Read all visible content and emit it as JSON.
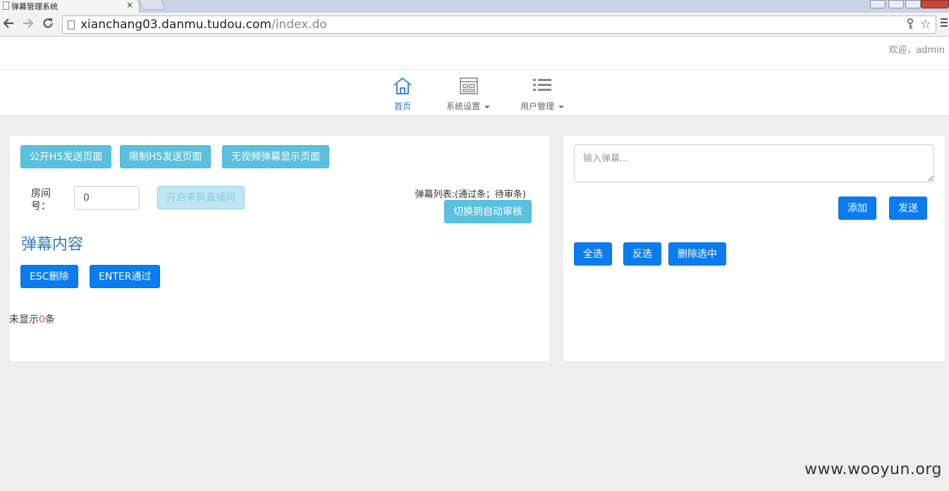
{
  "browser": {
    "tab_title": "弹幕管理系统",
    "tab_close": "×",
    "url_host": "xianchang03.danmu.tudou.com",
    "url_path": "/index.do"
  },
  "header": {
    "welcome": "欢迎，admin"
  },
  "nav": {
    "items": [
      {
        "label": "首页",
        "icon": "home-icon"
      },
      {
        "label": "系统设置",
        "icon": "settings-window-icon"
      },
      {
        "label": "用户管理",
        "icon": "list-icon"
      }
    ]
  },
  "left_panel": {
    "buttons": {
      "public_h5": "公开H5发送页面",
      "limit_h5": "限制H5发送页面",
      "no_video": "无视频弹幕显示页面"
    },
    "room_label": "房间号：",
    "room_value": "0",
    "start_live": "开启来疯直播间",
    "list_status": "弹幕列表:(通过条；待审条)",
    "switch_auto": "切换到自动审核",
    "section_title": "弹幕内容",
    "esc_delete": "ESC删除",
    "enter_pass": "ENTER通过",
    "count_prefix": "未显示",
    "count_value": "0",
    "count_suffix": "条"
  },
  "right_panel": {
    "danmu_placeholder": "输入弹幕...",
    "add": "添加",
    "send": "发送",
    "select_all": "全选",
    "invert": "反选",
    "delete_selected": "删除选中"
  },
  "watermark": "www.wooyun.org",
  "colors": {
    "info": "#5bc0de",
    "primary": "#0a7cf0",
    "nav_active": "#2f7bc2",
    "title": "#337ab7"
  }
}
